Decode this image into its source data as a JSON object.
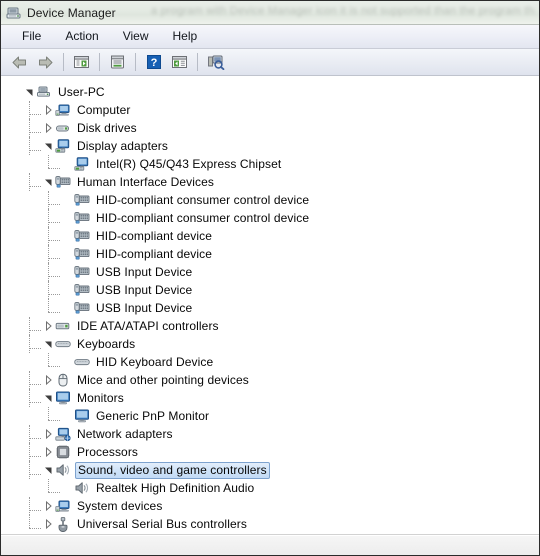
{
  "window": {
    "title": "Device Manager",
    "title_icon": "device-manager-icon",
    "ghost_text": "a program with Device Manager icon it is not supported than the program that"
  },
  "menubar": {
    "items": [
      {
        "label": "File",
        "name": "menu-file"
      },
      {
        "label": "Action",
        "name": "menu-action"
      },
      {
        "label": "View",
        "name": "menu-view"
      },
      {
        "label": "Help",
        "name": "menu-help"
      }
    ]
  },
  "toolbar": {
    "buttons": [
      {
        "name": "back-button",
        "icon": "arrow-left-icon",
        "tooltip": "Back"
      },
      {
        "name": "forward-button",
        "icon": "arrow-right-icon",
        "tooltip": "Forward"
      },
      {
        "name": "separator-1",
        "icon": "separator",
        "tooltip": ""
      },
      {
        "name": "show-hide-tree-button",
        "icon": "tree-pane-icon",
        "tooltip": "Show/Hide Console Tree"
      },
      {
        "name": "separator-2",
        "icon": "separator",
        "tooltip": ""
      },
      {
        "name": "properties-button",
        "icon": "properties-icon",
        "tooltip": "Properties"
      },
      {
        "name": "separator-3",
        "icon": "separator",
        "tooltip": ""
      },
      {
        "name": "help-button",
        "icon": "question-mark-icon",
        "tooltip": "Help"
      },
      {
        "name": "show-hide-action-button",
        "icon": "action-pane-icon",
        "tooltip": "Show/Hide Action Pane"
      },
      {
        "name": "separator-4",
        "icon": "separator",
        "tooltip": ""
      },
      {
        "name": "scan-hardware-button",
        "icon": "scan-hardware-icon",
        "tooltip": "Scan for hardware changes"
      }
    ]
  },
  "tree": {
    "nodes": [
      {
        "label": "User-PC",
        "depth": 0,
        "state": "expanded",
        "icon": "computer-tower-icon",
        "selected": false
      },
      {
        "label": "Computer",
        "depth": 1,
        "state": "collapsed",
        "icon": "computer-icon",
        "selected": false
      },
      {
        "label": "Disk drives",
        "depth": 1,
        "state": "collapsed",
        "icon": "disk-drive-icon",
        "selected": false
      },
      {
        "label": "Display adapters",
        "depth": 1,
        "state": "expanded",
        "icon": "display-adapter-icon",
        "selected": false
      },
      {
        "label": "Intel(R) Q45/Q43 Express Chipset",
        "depth": 2,
        "state": "leaf",
        "icon": "display-adapter-icon",
        "selected": false
      },
      {
        "label": "Human Interface Devices",
        "depth": 1,
        "state": "expanded",
        "icon": "hid-icon",
        "selected": false
      },
      {
        "label": "HID-compliant consumer control device",
        "depth": 2,
        "state": "leaf",
        "icon": "hid-icon",
        "selected": false
      },
      {
        "label": "HID-compliant consumer control device",
        "depth": 2,
        "state": "leaf",
        "icon": "hid-icon",
        "selected": false
      },
      {
        "label": "HID-compliant device",
        "depth": 2,
        "state": "leaf",
        "icon": "hid-icon",
        "selected": false
      },
      {
        "label": "HID-compliant device",
        "depth": 2,
        "state": "leaf",
        "icon": "hid-icon",
        "selected": false
      },
      {
        "label": "USB Input Device",
        "depth": 2,
        "state": "leaf",
        "icon": "hid-icon",
        "selected": false
      },
      {
        "label": "USB Input Device",
        "depth": 2,
        "state": "leaf",
        "icon": "hid-icon",
        "selected": false
      },
      {
        "label": "USB Input Device",
        "depth": 2,
        "state": "leaf",
        "icon": "hid-icon",
        "selected": false
      },
      {
        "label": "IDE ATA/ATAPI controllers",
        "depth": 1,
        "state": "collapsed",
        "icon": "ide-controller-icon",
        "selected": false
      },
      {
        "label": "Keyboards",
        "depth": 1,
        "state": "expanded",
        "icon": "keyboard-icon",
        "selected": false
      },
      {
        "label": "HID Keyboard Device",
        "depth": 2,
        "state": "leaf",
        "icon": "keyboard-icon",
        "selected": false
      },
      {
        "label": "Mice and other pointing devices",
        "depth": 1,
        "state": "collapsed",
        "icon": "mouse-icon",
        "selected": false
      },
      {
        "label": "Monitors",
        "depth": 1,
        "state": "expanded",
        "icon": "monitor-icon",
        "selected": false
      },
      {
        "label": "Generic PnP Monitor",
        "depth": 2,
        "state": "leaf",
        "icon": "monitor-icon",
        "selected": false
      },
      {
        "label": "Network adapters",
        "depth": 1,
        "state": "collapsed",
        "icon": "network-adapter-icon",
        "selected": false
      },
      {
        "label": "Processors",
        "depth": 1,
        "state": "collapsed",
        "icon": "processor-icon",
        "selected": false
      },
      {
        "label": "Sound, video and game controllers",
        "depth": 1,
        "state": "expanded",
        "icon": "speaker-icon",
        "selected": true
      },
      {
        "label": "Realtek High Definition Audio",
        "depth": 2,
        "state": "leaf",
        "icon": "speaker-icon",
        "selected": false
      },
      {
        "label": "System devices",
        "depth": 1,
        "state": "collapsed",
        "icon": "computer-icon",
        "selected": false
      },
      {
        "label": "Universal Serial Bus controllers",
        "depth": 1,
        "state": "collapsed",
        "icon": "usb-icon",
        "selected": false
      }
    ]
  },
  "statusbar": {
    "text": ""
  },
  "colors": {
    "selection_border": "#7da2ce",
    "selection_fill": "#cfe3f8",
    "window_border": "#2b2b2b",
    "accent_blue": "#2d6fbe",
    "icon_green": "#3f8f3f"
  }
}
